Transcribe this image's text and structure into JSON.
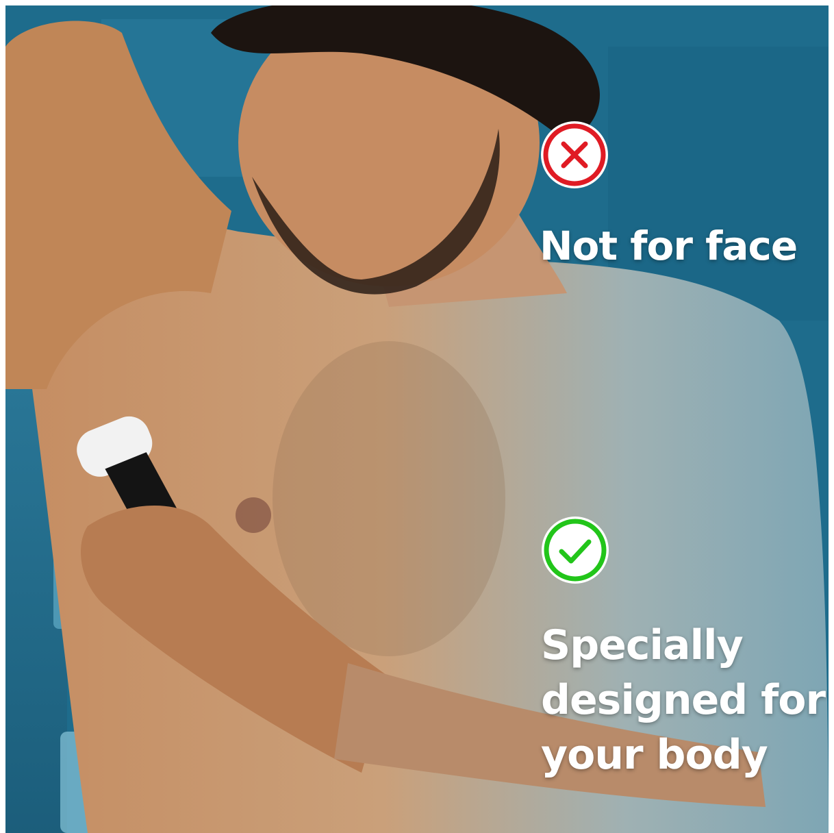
{
  "badges": {
    "cross": {
      "icon": "cross-circle-icon",
      "color": "#e01b24"
    },
    "check": {
      "icon": "check-circle-icon",
      "color": "#22c51a"
    }
  },
  "captions": {
    "not_for_face": "Not for face",
    "body_line1": "Specially",
    "body_line2": "designed for",
    "body_line3": "your body"
  },
  "colors": {
    "background_blue": "#1f6e8e",
    "text": "#ffffff"
  }
}
